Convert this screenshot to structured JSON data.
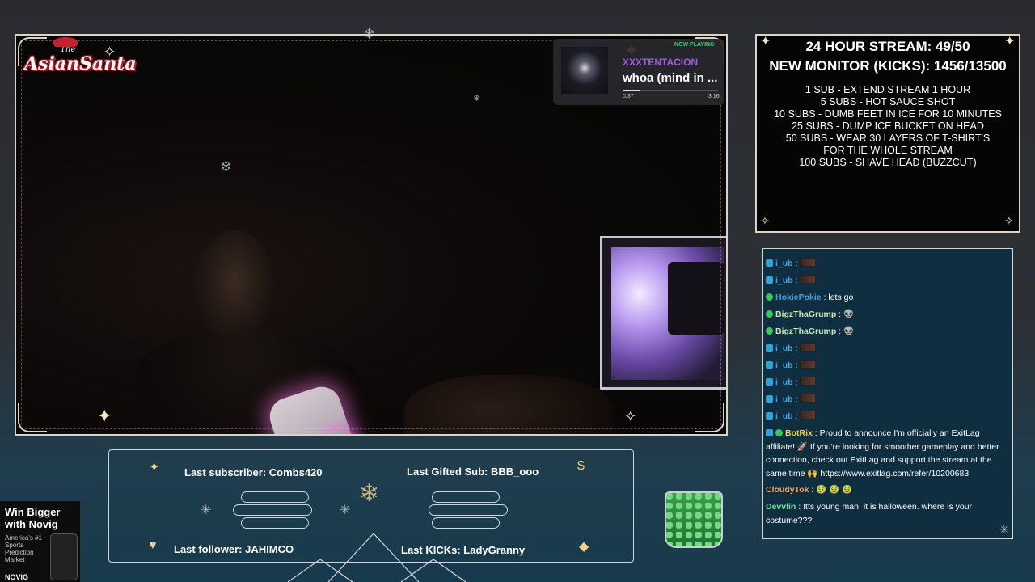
{
  "now_playing": {
    "badge": "NOW PLAYING",
    "artist": "XXXTENTACION",
    "title": "whoa (mind in ...",
    "elapsed": "0:37",
    "duration": "3:16",
    "progress": 0.19
  },
  "logo": {
    "the": "The",
    "name": "AsianSanta"
  },
  "goals": {
    "stream_line": "24 HOUR STREAM: 49/50",
    "monitor_line": "NEW MONITOR (KICKS): 1456/13500",
    "items": [
      "1 SUB - EXTEND STREAM 1 HOUR",
      "5 SUBS - HOT SAUCE SHOT",
      "10 SUBS - DUMB FEET IN ICE FOR 10 MINUTES",
      "25 SUBS - DUMP ICE BUCKET ON HEAD",
      "50 SUBS - WEAR 30 LAYERS OF T-SHIRT'S",
      "FOR THE WHOLE STREAM",
      "100 SUBS - SHAVE HEAD (BUZZCUT)"
    ]
  },
  "chat": {
    "messages": [
      {
        "user": "i_ub",
        "color": "#3da6e8",
        "badge": "sub",
        "text": ":",
        "emote": true
      },
      {
        "user": "i_ub",
        "color": "#3da6e8",
        "badge": "sub",
        "text": ":",
        "emote": true
      },
      {
        "user": "HokiePokie",
        "color": "#3da6e8",
        "badge": "ok",
        "text": ": lets go",
        "emote": false
      },
      {
        "user": "BigzThaGrump",
        "color": "#c8e8b8",
        "badge": "ok",
        "text": ":",
        "emote": true
      },
      {
        "user": "BigzThaGrump",
        "color": "#c8e8b8",
        "badge": "ok",
        "text": ":",
        "emote": true
      },
      {
        "user": "i_ub",
        "color": "#3da6e8",
        "badge": "sub",
        "text": ":",
        "emote": true
      },
      {
        "user": "i_ub",
        "color": "#3da6e8",
        "badge": "sub",
        "text": ":",
        "emote": true
      },
      {
        "user": "i_ub",
        "color": "#3da6e8",
        "badge": "sub",
        "text": ":",
        "emote": true
      },
      {
        "user": "i_ub",
        "color": "#3da6e8",
        "badge": "sub",
        "text": ":",
        "emote": true
      },
      {
        "user": "i_ub",
        "color": "#3da6e8",
        "badge": "sub",
        "text": ":",
        "emote": true
      }
    ],
    "botrix": {
      "user": "BotRix",
      "text": ": Proud to announce I'm officially an ExitLag affiliate! 🚀 If you're looking for smoother gameplay and better connection, check out ExitLag and support the stream at the same time 🙌 https://www.exitlag.com/refer/10200683"
    },
    "cloudytok": {
      "user": "CloudyTok",
      "text": ":"
    },
    "devvlin": {
      "user": "Devvlin",
      "text": ": !tts young man. it is halloween. where is your costume???"
    }
  },
  "alerts": {
    "last_subscriber": "Last subscriber: Combs420",
    "last_gifted": "Last Gifted Sub: BBB_ooo",
    "last_follower": "Last follower: JAHIMCO",
    "last_kicks": "Last KICKs: LadyGranny"
  },
  "ad": {
    "headline": "Win Bigger with Novig",
    "sub": "America's #1 Sports Prediction Market",
    "brand": "NOVIG"
  },
  "colors": {
    "accent_purple": "#9a5fe0",
    "chat_bg": "#0f2e3f",
    "frame": "#d9d4c6"
  }
}
